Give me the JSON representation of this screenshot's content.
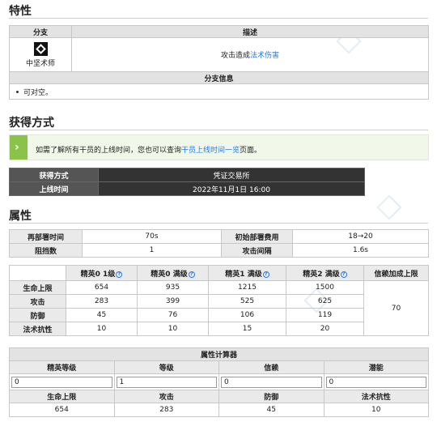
{
  "sections": {
    "traits": "特性",
    "obtain": "获得方式",
    "attributes": "属性"
  },
  "traits": {
    "branch_header": "分支",
    "desc_header": "描述",
    "branch_name": "中坚术师",
    "desc_prefix": "攻击造成",
    "desc_link": "法术伤害",
    "branch_info_header": "分支信息",
    "branch_info_item": "可对空。"
  },
  "notice": {
    "prefix": "如需了解所有干员的上线时间，您也可以查询",
    "link": "干员上线时间一览",
    "suffix": "页面。"
  },
  "obtain": {
    "method_label": "获得方式",
    "method_value": "凭证交易所",
    "release_label": "上线时间",
    "release_value": "2022年11月1日 16:00"
  },
  "basic": {
    "redeploy_label": "再部署时间",
    "redeploy_value": "70s",
    "initial_cost_label": "初始部署费用",
    "initial_cost_value": "18→20",
    "block_label": "阻挡数",
    "block_value": "1",
    "interval_label": "攻击间隔",
    "interval_value": "1.6s"
  },
  "stats": {
    "headers": [
      "精英0 1级",
      "精英0 满级",
      "精英1 满级",
      "精英2 满级",
      "信赖加成上限"
    ],
    "help_glyph": "?",
    "rows": [
      {
        "label": "生命上限",
        "values": [
          "654",
          "935",
          "1215",
          "1500"
        ]
      },
      {
        "label": "攻击",
        "values": [
          "283",
          "399",
          "525",
          "625"
        ]
      },
      {
        "label": "防御",
        "values": [
          "45",
          "76",
          "106",
          "119"
        ]
      },
      {
        "label": "法术抗性",
        "values": [
          "10",
          "10",
          "15",
          "20"
        ]
      }
    ],
    "trust_bonus": "70"
  },
  "calculator": {
    "title": "属性计算器",
    "input_labels": [
      "精英等级",
      "等级",
      "信赖",
      "潜能"
    ],
    "input_values": [
      "0",
      "1",
      "0",
      "0"
    ],
    "result_labels": [
      "生命上限",
      "攻击",
      "防御",
      "法术抗性"
    ],
    "result_values": [
      "654",
      "283",
      "45",
      "10"
    ]
  }
}
